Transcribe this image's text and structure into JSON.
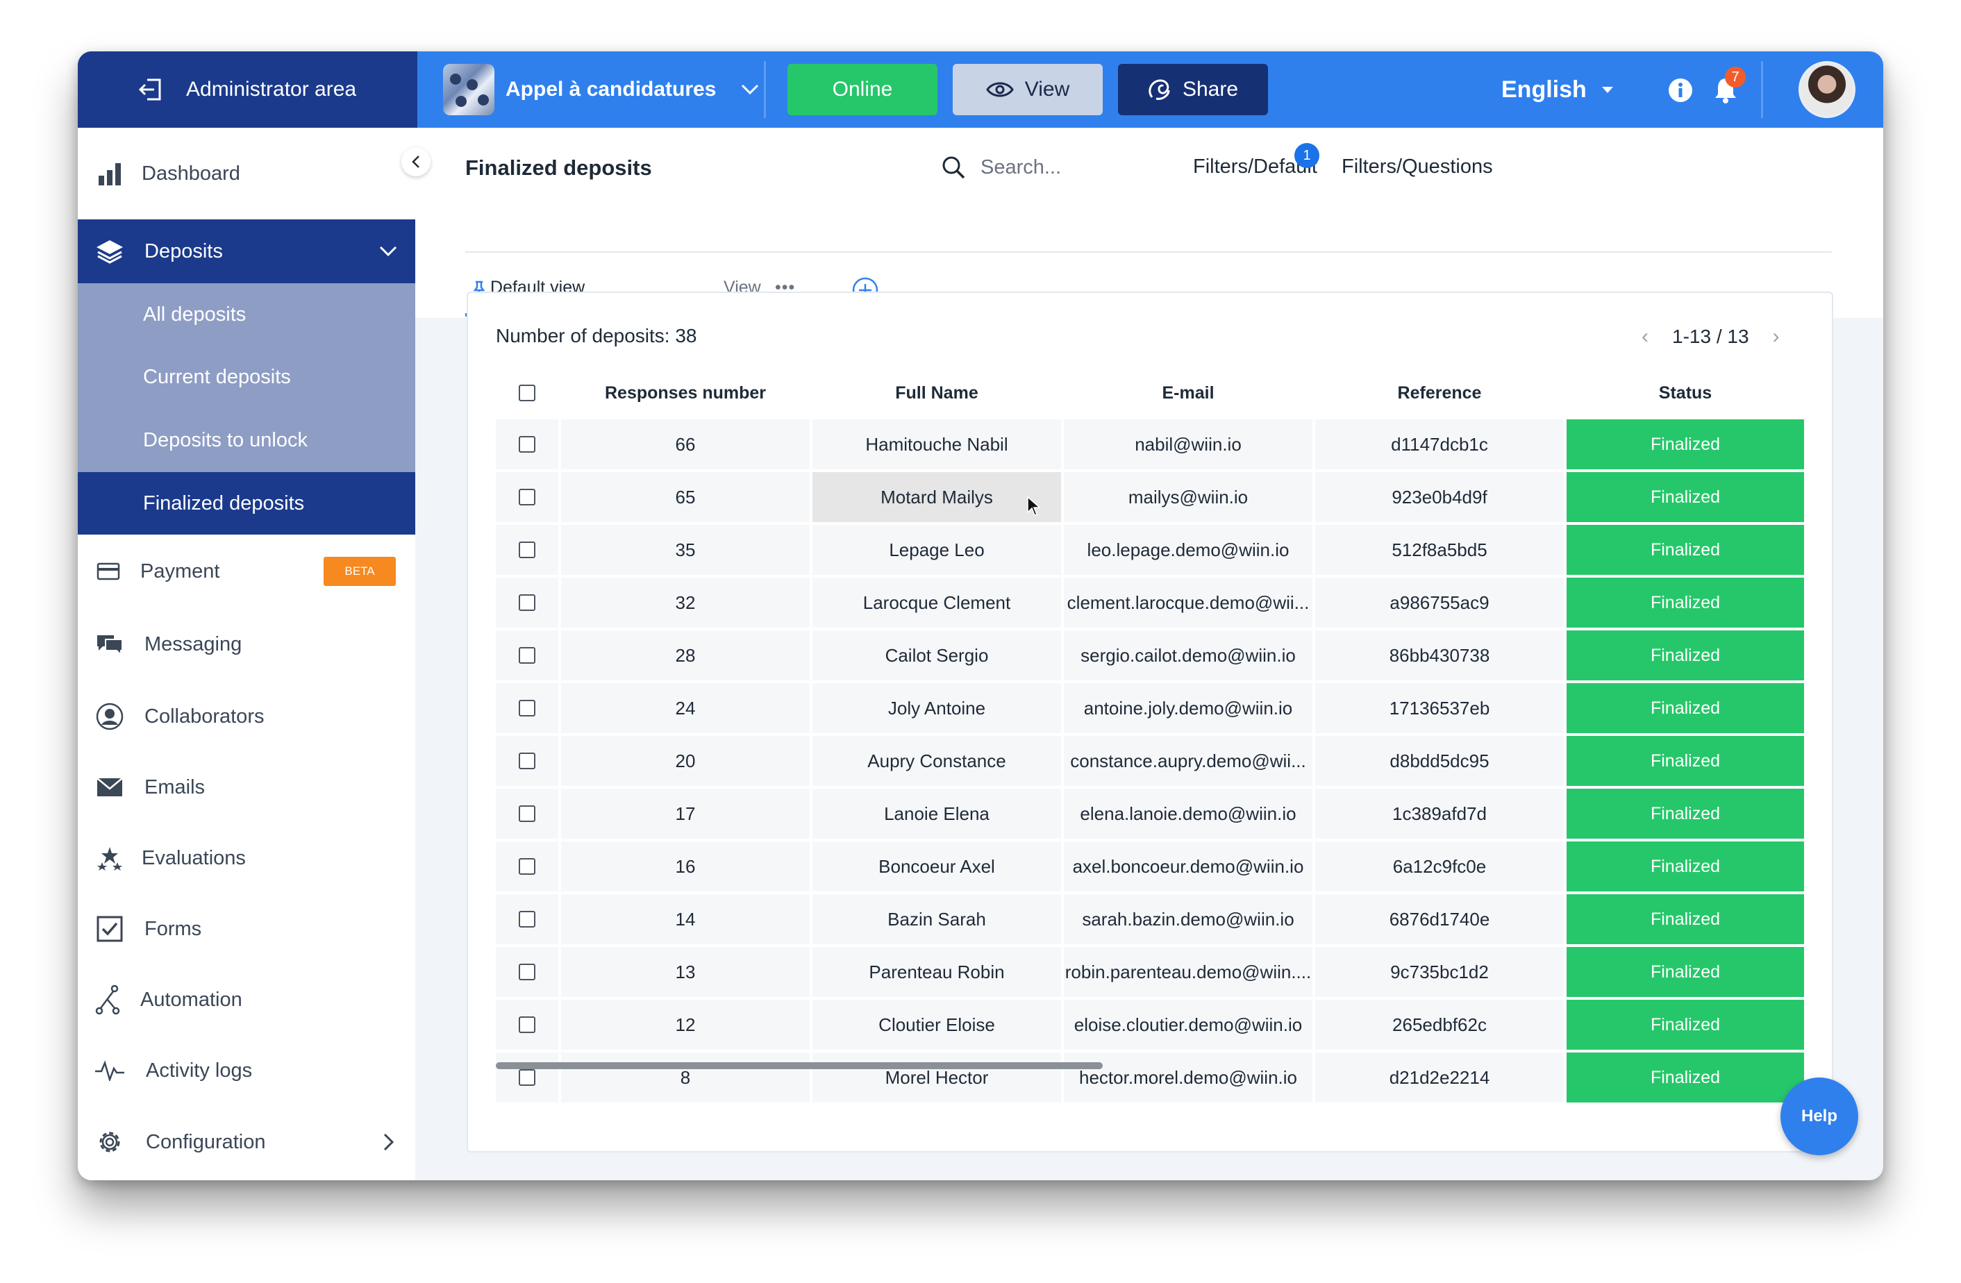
{
  "topbar": {
    "admin_label": "Administrator area",
    "project_name": "Appel à candidatures",
    "online_label": "Online",
    "view_label": "View",
    "share_label": "Share",
    "language": "English",
    "notification_count": "7"
  },
  "sidebar": {
    "dashboard": "Dashboard",
    "deposits": "Deposits",
    "sub_items": [
      "All deposits",
      "Current deposits",
      "Deposits to unlock",
      "Finalized deposits"
    ],
    "payment": "Payment",
    "beta_badge": "BETA",
    "messaging": "Messaging",
    "collaborators": "Collaborators",
    "emails": "Emails",
    "evaluations": "Evaluations",
    "forms": "Forms",
    "automation": "Automation",
    "activity_logs": "Activity logs",
    "configuration": "Configuration"
  },
  "header": {
    "title": "Finalized deposits",
    "search_placeholder": "Search...",
    "filters_default": "Filters/Default",
    "filters_badge": "1",
    "filters_questions": "Filters/Questions"
  },
  "tabs": {
    "default_view": "Default view",
    "view": "View",
    "dots": "•••"
  },
  "table": {
    "count_label": "Number of deposits: 38",
    "pager": "1-13 / 13",
    "columns": [
      "Responses number",
      "Full Name",
      "E-mail",
      "Reference",
      "Status"
    ],
    "rows": [
      {
        "responses": "66",
        "name": "Hamitouche Nabil",
        "email": "nabil@wiin.io",
        "reference": "d1147dcb1c",
        "status": "Finalized"
      },
      {
        "responses": "65",
        "name": "Motard Mailys",
        "email": "mailys@wiin.io",
        "reference": "923e0b4d9f",
        "status": "Finalized"
      },
      {
        "responses": "35",
        "name": "Lepage Leo",
        "email": "leo.lepage.demo@wiin.io",
        "reference": "512f8a5bd5",
        "status": "Finalized"
      },
      {
        "responses": "32",
        "name": "Larocque Clement",
        "email": "clement.larocque.demo@wii...",
        "reference": "a986755ac9",
        "status": "Finalized"
      },
      {
        "responses": "28",
        "name": "Cailot Sergio",
        "email": "sergio.cailot.demo@wiin.io",
        "reference": "86bb430738",
        "status": "Finalized"
      },
      {
        "responses": "24",
        "name": "Joly Antoine",
        "email": "antoine.joly.demo@wiin.io",
        "reference": "17136537eb",
        "status": "Finalized"
      },
      {
        "responses": "20",
        "name": "Aupry Constance",
        "email": "constance.aupry.demo@wii...",
        "reference": "d8bdd5dc95",
        "status": "Finalized"
      },
      {
        "responses": "17",
        "name": "Lanoie Elena",
        "email": "elena.lanoie.demo@wiin.io",
        "reference": "1c389afd7d",
        "status": "Finalized"
      },
      {
        "responses": "16",
        "name": "Boncoeur Axel",
        "email": "axel.boncoeur.demo@wiin.io",
        "reference": "6a12c9fc0e",
        "status": "Finalized"
      },
      {
        "responses": "14",
        "name": "Bazin Sarah",
        "email": "sarah.bazin.demo@wiin.io",
        "reference": "6876d1740e",
        "status": "Finalized"
      },
      {
        "responses": "13",
        "name": "Parenteau Robin",
        "email": "robin.parenteau.demo@wiin....",
        "reference": "9c735bc1d2",
        "status": "Finalized"
      },
      {
        "responses": "12",
        "name": "Cloutier Eloise",
        "email": "eloise.cloutier.demo@wiin.io",
        "reference": "265edbf62c",
        "status": "Finalized"
      },
      {
        "responses": "8",
        "name": "Morel Hector",
        "email": "hector.morel.demo@wiin.io",
        "reference": "d21d2e2214",
        "status": "Finalized"
      }
    ]
  },
  "help_label": "Help",
  "colors": {
    "topbar": "#2f80ed",
    "navy": "#1b3a8c",
    "finalized": "#26c76a",
    "online": "#26c76a",
    "beta": "#f6891f"
  }
}
